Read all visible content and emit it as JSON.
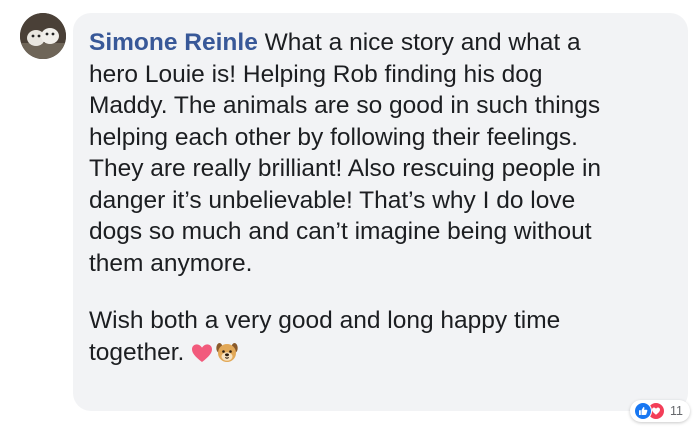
{
  "comment": {
    "author": "Simone Reinle",
    "paragraph_1": "What a nice story and what a\nhero Louie is! Helping Rob finding his dog\nMaddy. The animals are so good in such things\nhelping each other by following their feelings.\nThey are really brilliant! Also rescuing people in\ndanger it’s unbelievable! That’s why I do love\ndogs so much and can’t imagine being without\nthem anymore.",
    "paragraph_2": "Wish both a very good and long happy time\ntogether.",
    "emojis": [
      "heart-icon",
      "dog-face-icon"
    ]
  },
  "reactions": {
    "icons": [
      "like-icon",
      "love-icon"
    ],
    "count": "11"
  },
  "colors": {
    "author": "#385898",
    "bubble": "#f2f3f5",
    "like": "#1877f2",
    "love": "#f33e58"
  }
}
